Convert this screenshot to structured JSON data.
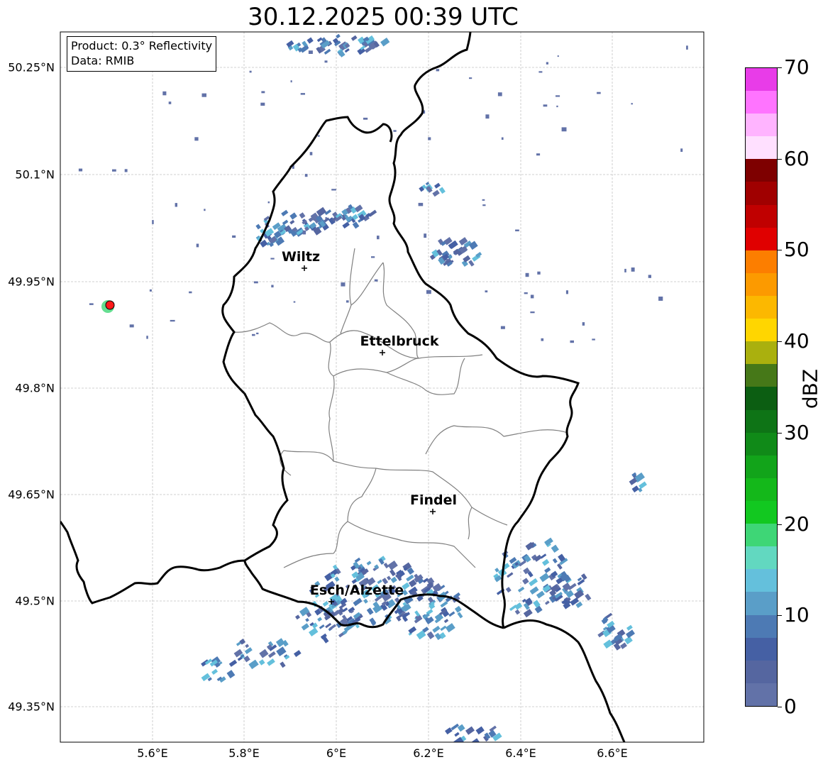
{
  "title": "30.12.2025 00:39 UTC",
  "info": {
    "product": "Product: 0.3° Reflectivity",
    "data": "Data: RMIB"
  },
  "lat_labels": [
    "50.25°N",
    "50.1°N",
    "49.95°N",
    "49.8°N",
    "49.65°N",
    "49.5°N",
    "49.35°N"
  ],
  "lon_labels": [
    "5.6°E",
    "5.8°E",
    "6°E",
    "6.2°E",
    "6.4°E",
    "6.6°E"
  ],
  "cities": [
    "Wiltz",
    "Ettelbruck",
    "Findel",
    "Esch/Alzette"
  ],
  "colorbar": {
    "label": "dBZ",
    "ticks": [
      "0",
      "10",
      "20",
      "30",
      "40",
      "50",
      "60",
      "70"
    ],
    "range": [
      0,
      70
    ],
    "colors": [
      "#6272a8",
      "#5566a0",
      "#4560a4",
      "#4d7ab4",
      "#5a9ec8",
      "#64c0dc",
      "#62d8c0",
      "#3ed676",
      "#12c820",
      "#14b81a",
      "#12a41a",
      "#108a18",
      "#0e7416",
      "#0c5e12",
      "#467818",
      "#aab00e",
      "#ffd600",
      "#fcb800",
      "#fc9a00",
      "#fc7e00",
      "#e00000",
      "#c00000",
      "#a00000",
      "#7e0000",
      "#ffe0ff",
      "#ffb4ff",
      "#ff74ff",
      "#e83ce8"
    ]
  },
  "radar_marker": {
    "color": "#ff1a1a"
  }
}
